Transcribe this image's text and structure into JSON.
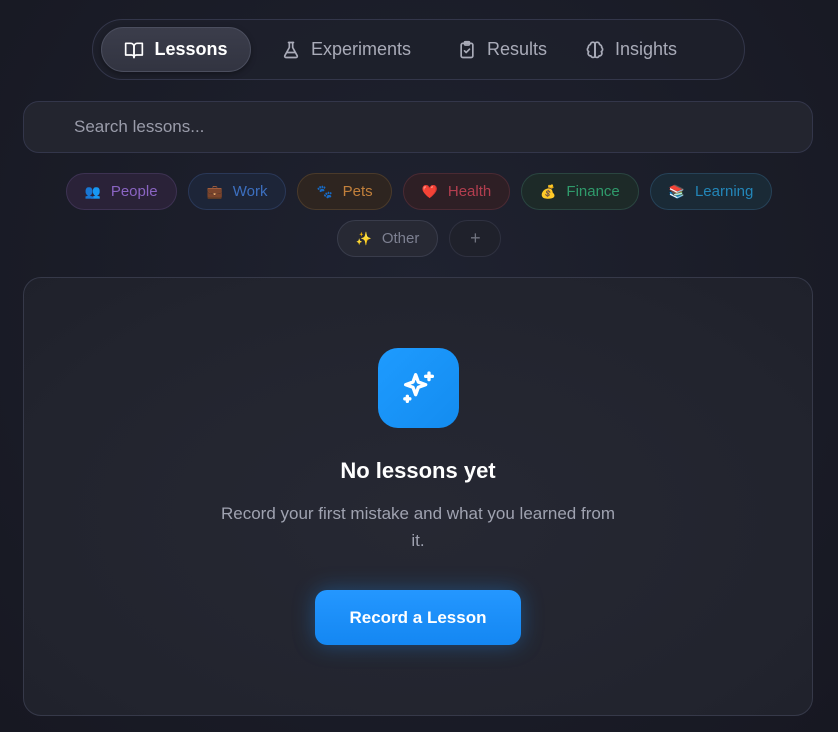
{
  "tabs": [
    {
      "label": "Lessons",
      "icon": "book-open-icon",
      "active": true
    },
    {
      "label": "Experiments",
      "icon": "flask-icon",
      "active": false
    },
    {
      "label": "Results",
      "icon": "clipboard-check-icon",
      "active": false
    },
    {
      "label": "Insights",
      "icon": "brain-icon",
      "active": false
    }
  ],
  "search": {
    "placeholder": "Search lessons...",
    "value": ""
  },
  "categories": [
    {
      "label": "People",
      "emoji": "👥",
      "color": "#8a64c2"
    },
    {
      "label": "Work",
      "emoji": "💼",
      "color": "#3c6fbf"
    },
    {
      "label": "Pets",
      "emoji": "🐾",
      "color": "#c2803b"
    },
    {
      "label": "Health",
      "emoji": "❤️",
      "color": "#b33e4f"
    },
    {
      "label": "Finance",
      "emoji": "💰",
      "color": "#2f9a6b"
    },
    {
      "label": "Learning",
      "emoji": "📚",
      "color": "#2386b8"
    },
    {
      "label": "Other",
      "emoji": "✨",
      "color": "#7d8091"
    }
  ],
  "add_category": "+",
  "empty_state": {
    "icon": "sparkles-icon",
    "title": "No lessons yet",
    "description": "Record your first mistake and what you learned from it.",
    "cta_label": "Record a Lesson"
  },
  "colors": {
    "accent": "#1e9bff",
    "background": "#1a1c27"
  }
}
